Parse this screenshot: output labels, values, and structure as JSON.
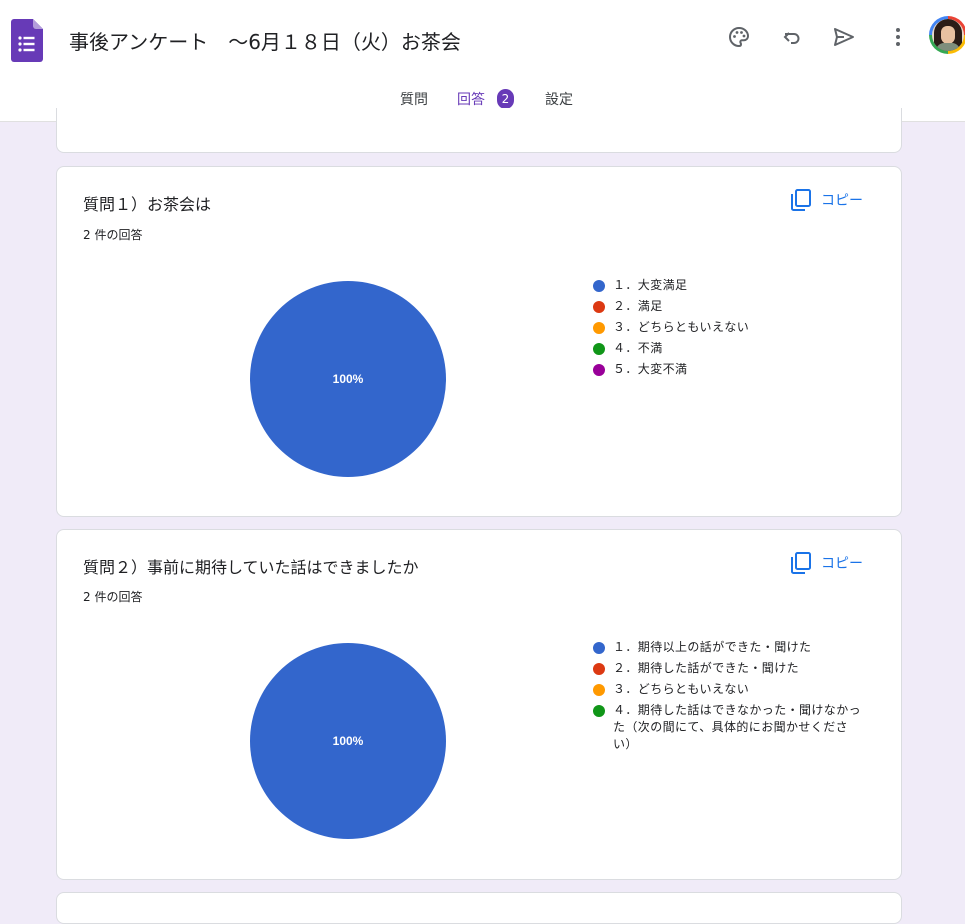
{
  "header": {
    "title": "事後アンケート　～6月１８日（火）お茶会",
    "icons": [
      "forms-logo-icon",
      "palette-icon",
      "undo-icon",
      "send-icon",
      "more-vert-icon"
    ]
  },
  "tabs": [
    {
      "label": "質問"
    },
    {
      "label": "回答",
      "badge": "2"
    },
    {
      "label": "設定"
    }
  ],
  "colors": {
    "accent": "#673ab7",
    "link": "#1a73e8",
    "background": "#f0ebf8",
    "series": [
      "#3366cc",
      "#dc3912",
      "#ff9900",
      "#109618",
      "#990099"
    ]
  },
  "questions": [
    {
      "title": "質問１）お茶会は",
      "count": "2 件の回答",
      "copy_label": "コピー",
      "pie_label": "100%",
      "legend": [
        "１．大変満足",
        "２．満足",
        "３．どちらともいえない",
        "４．不満",
        "５．大変不満"
      ]
    },
    {
      "title": "質問２）事前に期待していた話はできましたか",
      "count": "2 件の回答",
      "copy_label": "コピー",
      "pie_label": "100%",
      "legend": [
        "１．期待以上の話ができた・聞けた",
        "２．期待した話ができた・聞けた",
        "３．どちらともいえない",
        "４．期待した話はできなかった・聞けなかった（次の間にて、具体的にお聞かせください）"
      ]
    }
  ],
  "chart_data": [
    {
      "type": "pie",
      "categories": [
        "１．大変満足",
        "２．満足",
        "３．どちらともいえない",
        "４．不満",
        "５．大変不満"
      ],
      "values": [
        100,
        0,
        0,
        0,
        0
      ],
      "title": "質問１）お茶会は"
    },
    {
      "type": "pie",
      "categories": [
        "１．期待以上の話ができた・聞けた",
        "２．期待した話ができた・聞けた",
        "３．どちらともいえない",
        "４．期待した話はできなかった・聞けなかった（次の間にて、具体的にお聞かせください）"
      ],
      "values": [
        100,
        0,
        0,
        0
      ],
      "title": "質問２）事前に期待していた話はできましたか"
    }
  ]
}
